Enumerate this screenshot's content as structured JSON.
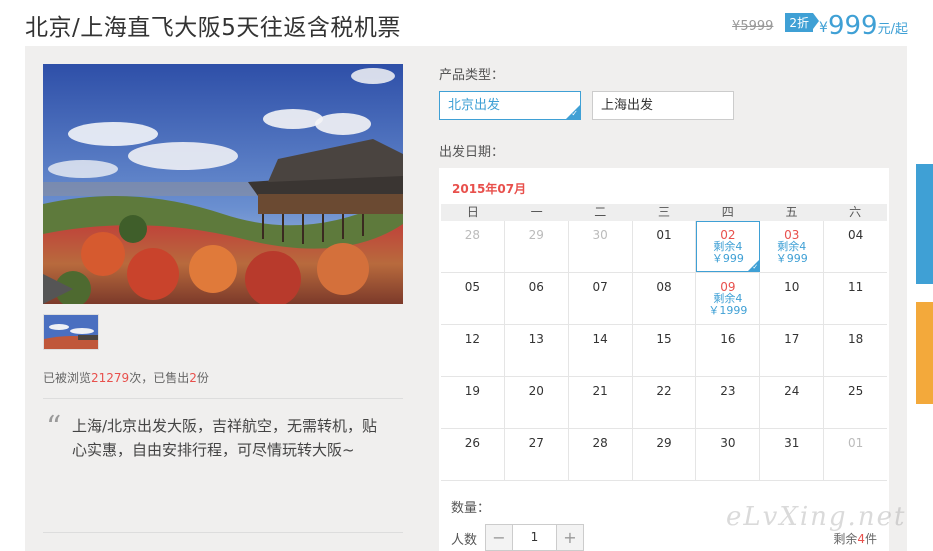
{
  "product": {
    "title": "北京/上海直飞大阪5天往返含税机票",
    "old_price": "¥5999",
    "discount": "2折",
    "price_currency": "¥",
    "price": "999",
    "price_unit": "元/起"
  },
  "gallery": {
    "stats_prefix": "已被浏览",
    "views": "21279",
    "stats_mid": "次，已售出",
    "sold": "2",
    "stats_suffix": "份"
  },
  "quote": {
    "mark": "“",
    "text": "上海/北京出发大阪，吉祥航空，无需转机，贴心实惠，自由安排行程，可尽情玩转大阪~"
  },
  "booking": {
    "product_type_label": "产品类型：",
    "product_types": [
      "北京出发",
      "上海出发"
    ],
    "selected_type": 0,
    "departure_label": "出发日期：",
    "quantity_label": "数量：",
    "people_label": "人数",
    "minus": "−",
    "plus": "+",
    "quantity": "1",
    "stock_prefix": "剩余",
    "stock": "4",
    "stock_suffix": "件"
  },
  "calendar": {
    "month": "2015年07月",
    "weekdays": [
      "日",
      "一",
      "二",
      "三",
      "四",
      "五",
      "六"
    ],
    "weeks": [
      [
        {
          "day": "28",
          "muted": true
        },
        {
          "day": "29",
          "muted": true
        },
        {
          "day": "30",
          "muted": true
        },
        {
          "day": "01"
        },
        {
          "day": "02",
          "remain": "剩余4",
          "price": "￥999",
          "selected": true
        },
        {
          "day": "03",
          "remain": "剩余4",
          "price": "￥999"
        },
        {
          "day": "04"
        }
      ],
      [
        {
          "day": "05"
        },
        {
          "day": "06"
        },
        {
          "day": "07"
        },
        {
          "day": "08"
        },
        {
          "day": "09",
          "remain": "剩余4",
          "price": "￥1999"
        },
        {
          "day": "10"
        },
        {
          "day": "11"
        }
      ],
      [
        {
          "day": "12"
        },
        {
          "day": "13"
        },
        {
          "day": "14"
        },
        {
          "day": "15"
        },
        {
          "day": "16"
        },
        {
          "day": "17"
        },
        {
          "day": "18"
        }
      ],
      [
        {
          "day": "19"
        },
        {
          "day": "20"
        },
        {
          "day": "21"
        },
        {
          "day": "22"
        },
        {
          "day": "23"
        },
        {
          "day": "24"
        },
        {
          "day": "25"
        }
      ],
      [
        {
          "day": "26"
        },
        {
          "day": "27"
        },
        {
          "day": "28"
        },
        {
          "day": "29"
        },
        {
          "day": "30"
        },
        {
          "day": "31"
        },
        {
          "day": "01",
          "muted": true
        }
      ]
    ]
  },
  "watermark": "eLvXing.net",
  "colors": {
    "accent": "#3fa0d5",
    "highlight": "#e8504c",
    "side_tab_blue": "#3fa0d5",
    "side_tab_orange": "#f3a93b"
  }
}
